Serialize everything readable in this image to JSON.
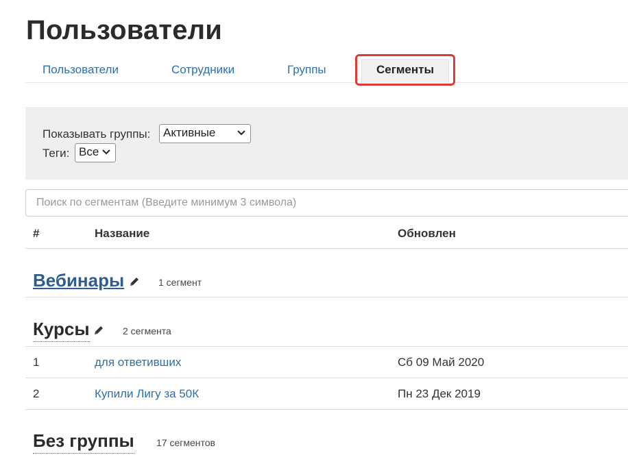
{
  "page": {
    "title": "Пользователи"
  },
  "tabs": [
    {
      "label": "Пользователи"
    },
    {
      "label": "Сотрудники"
    },
    {
      "label": "Группы"
    },
    {
      "label": "Сегменты",
      "active": true
    }
  ],
  "filters": {
    "groups_label": "Показывать группы:",
    "groups_value": "Активные",
    "tags_label": "Теги:",
    "tags_value": "Все"
  },
  "search": {
    "placeholder": "Поиск по сегментам (Введите минимум 3 символа)"
  },
  "table": {
    "headers": [
      "#",
      "Название",
      "Обновлен"
    ]
  },
  "groups": [
    {
      "title": "Вебинары",
      "count": "1 сегмент",
      "rows": []
    },
    {
      "title": "Курсы",
      "count": "2 сегмента",
      "rows": [
        {
          "num": "1",
          "name": "для ответивших",
          "updated": "Сб 09 Май 2020"
        },
        {
          "num": "2",
          "name": "Купили Лигу за 50К",
          "updated": "Пн 23 Дек 2019"
        }
      ]
    },
    {
      "title": "Без группы",
      "count": "17 сегментов",
      "rows": []
    }
  ],
  "colors": {
    "link": "#2a6fb0",
    "highlight": "#dd3c35",
    "panel": "#efefef"
  },
  "icons": [
    "pencil-icon",
    "chevron-down-icon"
  ]
}
